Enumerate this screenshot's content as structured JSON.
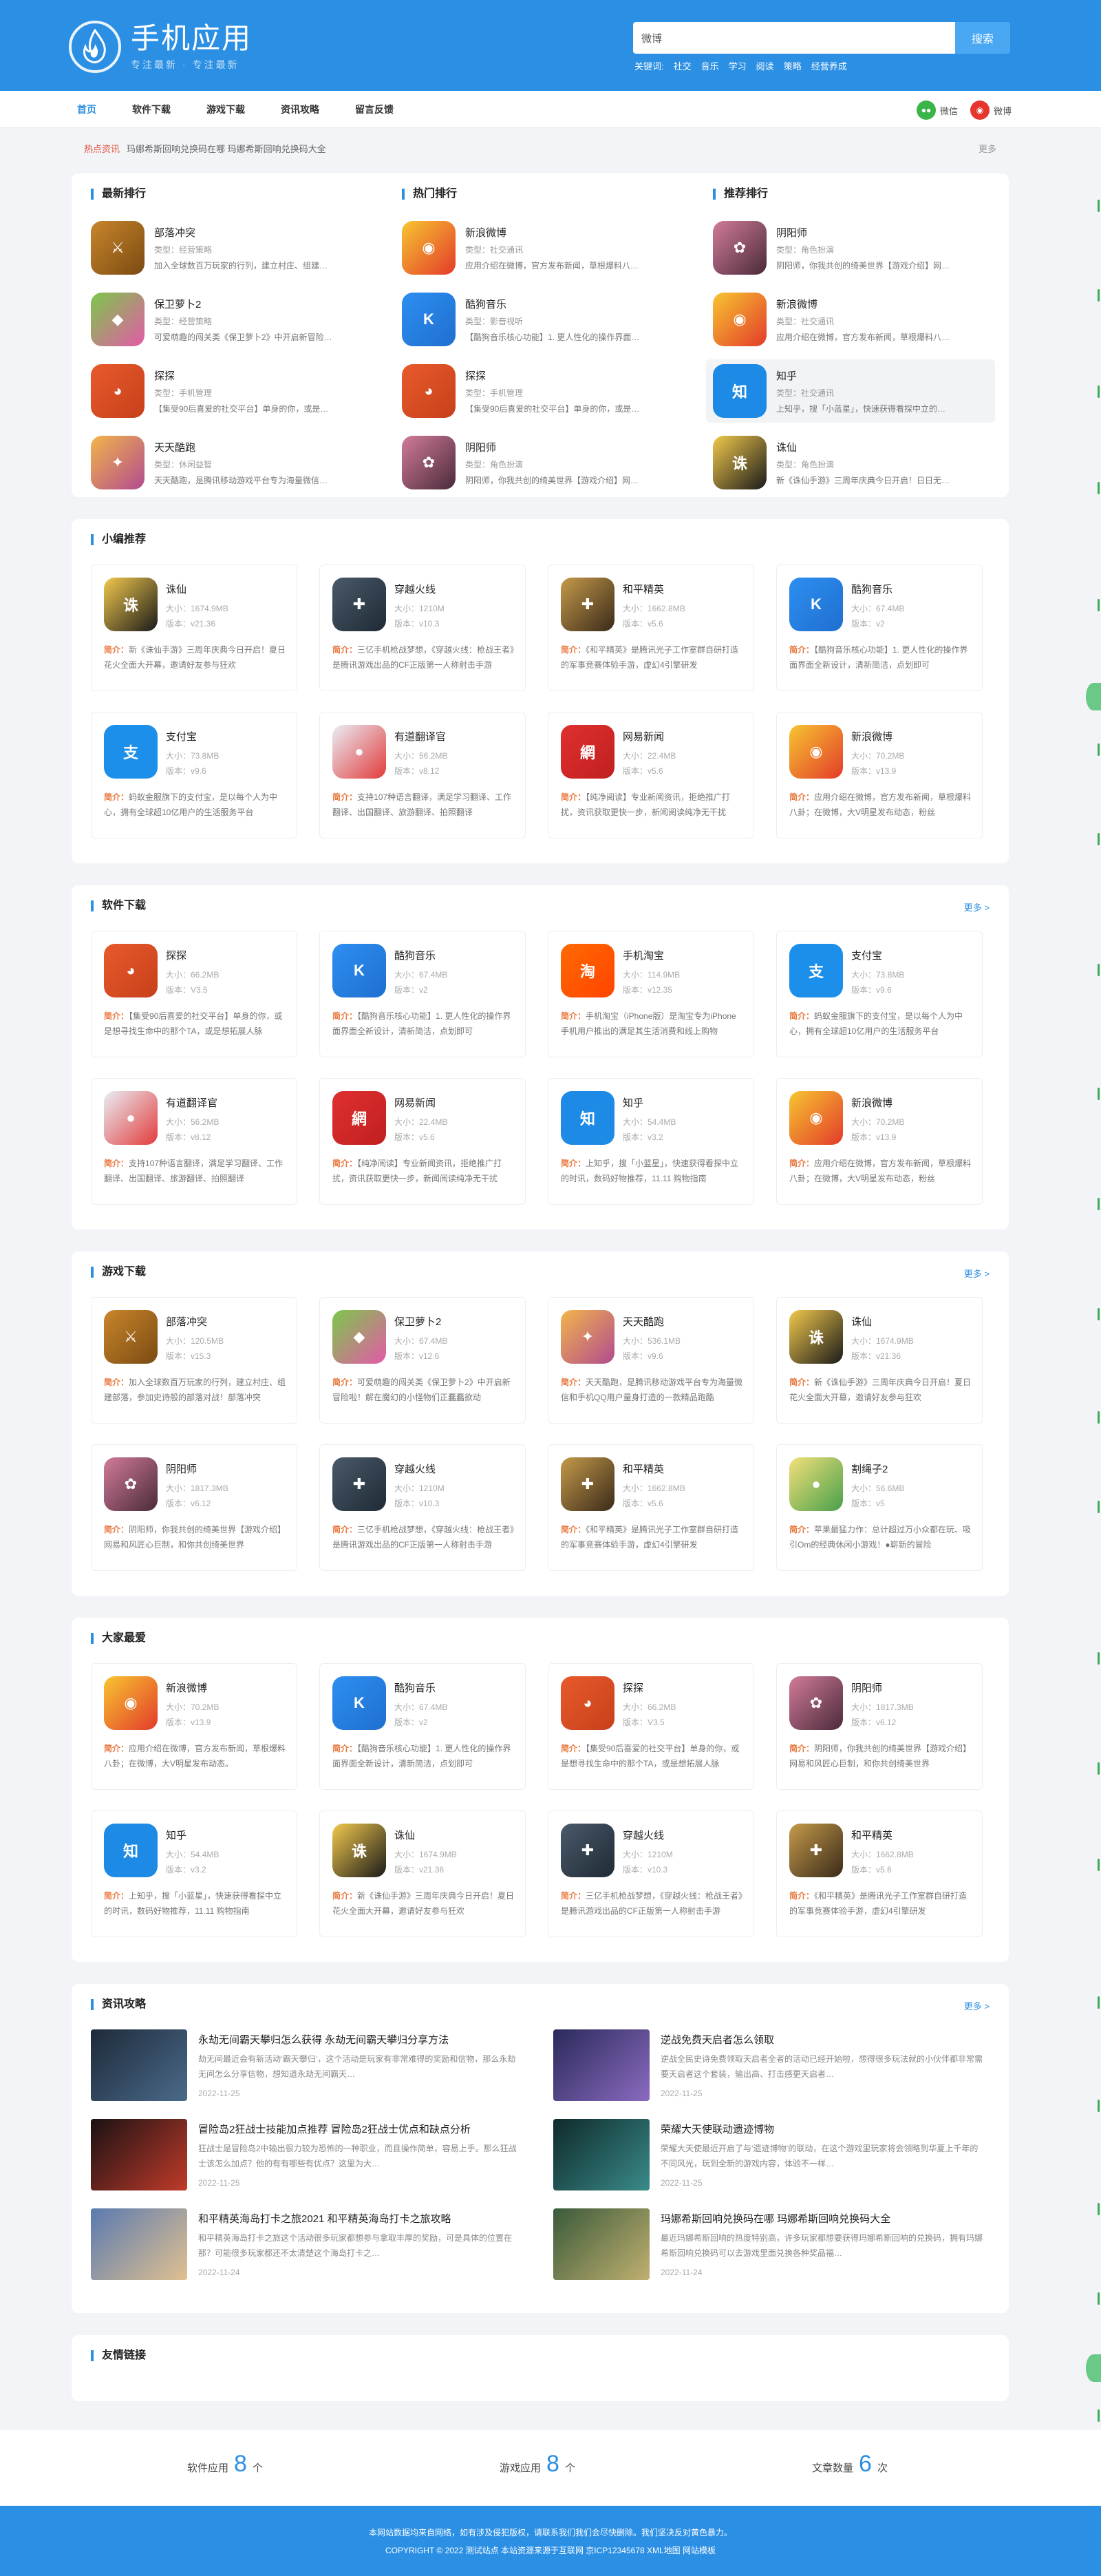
{
  "header": {
    "title": "手机应用",
    "slogan": "专注最新 · 专注最新",
    "search_value": "微博",
    "search_button": "搜索",
    "hotwords_label": "关键词:",
    "hotwords": [
      "社交",
      "音乐",
      "学习",
      "阅读",
      "策略",
      "经营养成"
    ]
  },
  "nav": {
    "items": [
      "首页",
      "软件下载",
      "游戏下载",
      "资讯攻略",
      "留言反馈"
    ],
    "share": [
      "微信",
      "微博"
    ]
  },
  "ticker": {
    "label": "热点资讯",
    "text": "玛娜希斯回响兑换码在哪 玛娜希斯回响兑换码大全",
    "more": "更多"
  },
  "rank": {
    "columns": [
      {
        "title": "最新排行",
        "items": [
          {
            "name": "部落冲突",
            "type": "类型：经营策略",
            "desc": "加入全球数百万玩家的行列，建立村庄、组建…"
          },
          {
            "name": "保卫萝卜2",
            "type": "类型：经营策略",
            "desc": "可爱萌趣的闯关类《保卫萝卜2》中开启新冒险…"
          },
          {
            "name": "探探",
            "type": "类型：手机管理",
            "desc": "【集受90后喜爱的社交平台】单身的你，或是…"
          },
          {
            "name": "天天酷跑",
            "type": "类型：休闲益智",
            "desc": "天天酷跑，是腾讯移动游戏平台专为海量微信…"
          }
        ]
      },
      {
        "title": "热门排行",
        "items": [
          {
            "name": "新浪微博",
            "type": "类型：社交通讯",
            "desc": "应用介绍在微博，官方发布新闻，草根爆料八…"
          },
          {
            "name": "酷狗音乐",
            "type": "类型：影音视听",
            "desc": "【酷狗音乐核心功能】1. 更人性化的操作界面…"
          },
          {
            "name": "探探",
            "type": "类型：手机管理",
            "desc": "【集受90后喜爱的社交平台】单身的你，或是…"
          },
          {
            "name": "阴阳师",
            "type": "类型：角色扮演",
            "desc": "阴阳师，你我共创的绮美世界【游戏介绍】网…"
          }
        ]
      },
      {
        "title": "推荐排行",
        "items": [
          {
            "name": "阴阳师",
            "type": "类型：角色扮演",
            "desc": "阴阳师，你我共创的绮美世界【游戏介绍】网…"
          },
          {
            "name": "新浪微博",
            "type": "类型：社交通讯",
            "desc": "应用介绍在微博，官方发布新闻，草根爆料八…"
          },
          {
            "name": "知乎",
            "type": "类型：社交通讯",
            "desc": "上知乎，搜「小蓝星」，快速获得看探中立的…"
          },
          {
            "name": "诛仙",
            "type": "类型：角色扮演",
            "desc": "新《诛仙手游》三周年庆典今日开启！日日无…"
          }
        ]
      }
    ]
  },
  "sections": [
    {
      "title": "小编推荐",
      "more": "",
      "cards": [
        {
          "name": "诛仙",
          "size": "大小：1674.9MB",
          "ver": "版本：v21.36",
          "desc": "新《诛仙手游》三周年庆典今日开启！夏日花火全面大开幕，邀请好友参与狂欢"
        },
        {
          "name": "穿越火线",
          "size": "大小：1210M",
          "ver": "版本：v10.3",
          "desc": "三亿手机枪战梦想，《穿越火线：枪战王者》是腾讯游戏出品的CF正版第一人称射击手游"
        },
        {
          "name": "和平精英",
          "size": "大小：1662.8MB",
          "ver": "版本：v5.6",
          "desc": "《和平精英》是腾讯光子工作室群自研打造的军事竞赛体验手游，虚幻4引擎研发"
        },
        {
          "name": "酷狗音乐",
          "size": "大小：67.4MB",
          "ver": "版本：v2",
          "desc": "【酷狗音乐核心功能】1. 更人性化的操作界面界面全新设计，清新简洁，点划即可"
        },
        {
          "name": "支付宝",
          "size": "大小：73.8MB",
          "ver": "版本：v9.6",
          "desc": "蚂蚁金服旗下的支付宝，是以每个人为中心，拥有全球超10亿用户的生活服务平台"
        },
        {
          "name": "有道翻译官",
          "size": "大小：56.2MB",
          "ver": "版本：v8.12",
          "desc": "支持107种语言翻译，满足学习翻译、工作翻译、出国翻译、旅游翻译、拍照翻译"
        },
        {
          "name": "网易新闻",
          "size": "大小：22.4MB",
          "ver": "版本：v5.6",
          "desc": "【纯净阅读】专业新闻资讯，拒绝推广打扰，资讯获取更快一步，新闻阅读纯净无干扰"
        },
        {
          "name": "新浪微博",
          "size": "大小：70.2MB",
          "ver": "版本：v13.9",
          "desc": "应用介绍在微博，官方发布新闻，草根爆料八卦；在微博，大V明星发布动态，粉丝"
        }
      ]
    },
    {
      "title": "软件下载",
      "more": "更多 >",
      "cards": [
        {
          "name": "探探",
          "size": "大小：66.2MB",
          "ver": "版本：V3.5",
          "desc": "【集受90后喜爱的社交平台】单身的你，或是想寻找生命中的那个TA，或是想拓展人脉"
        },
        {
          "name": "酷狗音乐",
          "size": "大小：67.4MB",
          "ver": "版本：v2",
          "desc": "【酷狗音乐核心功能】1. 更人性化的操作界面界面全新设计，清新简洁，点划即可"
        },
        {
          "name": "手机淘宝",
          "size": "大小：114.9MB",
          "ver": "版本：v12.35",
          "desc": "手机淘宝（iPhone版）是淘宝专为iPhone手机用户推出的满足其生活消费和线上购物"
        },
        {
          "name": "支付宝",
          "size": "大小：73.8MB",
          "ver": "版本：v9.6",
          "desc": "蚂蚁金服旗下的支付宝，是以每个人为中心，拥有全球超10亿用户的生活服务平台"
        },
        {
          "name": "有道翻译官",
          "size": "大小：56.2MB",
          "ver": "版本：v8.12",
          "desc": "支持107种语言翻译，满足学习翻译、工作翻译、出国翻译、旅游翻译、拍照翻译"
        },
        {
          "name": "网易新闻",
          "size": "大小：22.4MB",
          "ver": "版本：v5.6",
          "desc": "【纯净阅读】专业新闻资讯，拒绝推广打扰，资讯获取更快一步，新闻阅读纯净无干扰"
        },
        {
          "name": "知乎",
          "size": "大小：54.4MB",
          "ver": "版本：v3.2",
          "desc": "上知乎，搜「小蓝星」，快速获得看探中立的时讯，数码好物推荐，11.11 购物指南"
        },
        {
          "name": "新浪微博",
          "size": "大小：70.2MB",
          "ver": "版本：v13.9",
          "desc": "应用介绍在微博，官方发布新闻，草根爆料八卦；在微博，大V明星发布动态，粉丝"
        }
      ]
    },
    {
      "title": "游戏下载",
      "more": "更多 >",
      "cards": [
        {
          "name": "部落冲突",
          "size": "大小：120.5MB",
          "ver": "版本：v15.3",
          "desc": "加入全球数百万玩家的行列，建立村庄、组建部落，参加史诗般的部落对战！部落冲突"
        },
        {
          "name": "保卫萝卜2",
          "size": "大小：67.4MB",
          "ver": "版本：v12.6",
          "desc": "可爱萌趣的闯关类《保卫萝卜2》中开启新冒险啦！解在魔幻的小怪物们正蠢蠢欲动"
        },
        {
          "name": "天天酷跑",
          "size": "大小：536.1MB",
          "ver": "版本：v9.6",
          "desc": "天天酷跑，是腾讯移动游戏平台专为海量微信和手机QQ用户量身打造的一款精品跑酷"
        },
        {
          "name": "诛仙",
          "size": "大小：1674.9MB",
          "ver": "版本：v21.36",
          "desc": "新《诛仙手游》三周年庆典今日开启！夏日花火全面大开幕，邀请好友参与狂欢"
        },
        {
          "name": "阴阳师",
          "size": "大小：1817.3MB",
          "ver": "版本：v6.12",
          "desc": "阴阳师，你我共创的绮美世界【游戏介绍】网易和风匠心巨制，和你共创绮美世界"
        },
        {
          "name": "穿越火线",
          "size": "大小：1210M",
          "ver": "版本：v10.3",
          "desc": "三亿手机枪战梦想，《穿越火线：枪战王者》是腾讯游戏出品的CF正版第一人称射击手游"
        },
        {
          "name": "和平精英",
          "size": "大小：1662.8MB",
          "ver": "版本：v5.6",
          "desc": "《和平精英》是腾讯光子工作室群自研打造的军事竞赛体验手游，虚幻4引擎研发"
        },
        {
          "name": "割绳子2",
          "size": "大小：56.6MB",
          "ver": "版本：v5",
          "desc": "苹果最猛力作：总计超过万小众都在玩、吸引Om的经典休闲小游戏！●崭新的冒险"
        }
      ]
    },
    {
      "title": "大家最爱",
      "more": "",
      "cards": [
        {
          "name": "新浪微博",
          "size": "大小：70.2MB",
          "ver": "版本：v13.9",
          "desc": "应用介绍在微博，官方发布新闻，草根爆料八卦；在微博，大V明星发布动态。"
        },
        {
          "name": "酷狗音乐",
          "size": "大小：67.4MB",
          "ver": "版本：v2",
          "desc": "【酷狗音乐核心功能】1. 更人性化的操作界面界面全新设计，清新简洁，点划即可"
        },
        {
          "name": "探探",
          "size": "大小：66.2MB",
          "ver": "版本：V3.5",
          "desc": "【集受90后喜爱的社交平台】单身的你，或是想寻找生命中的那个TA，或是想拓展人脉"
        },
        {
          "name": "阴阳师",
          "size": "大小：1817.3MB",
          "ver": "版本：v6.12",
          "desc": "阴阳师，你我共创的绮美世界【游戏介绍】网易和风匠心巨制，和你共创绮美世界"
        },
        {
          "name": "知乎",
          "size": "大小：54.4MB",
          "ver": "版本：v3.2",
          "desc": "上知乎，搜「小蓝星」，快速获得看探中立的时讯，数码好物推荐，11.11 购物指南"
        },
        {
          "name": "诛仙",
          "size": "大小：1674.9MB",
          "ver": "版本：v21.36",
          "desc": "新《诛仙手游》三周年庆典今日开启！夏日花火全面大开幕，邀请好友参与狂欢"
        },
        {
          "name": "穿越火线",
          "size": "大小：1210M",
          "ver": "版本：v10.3",
          "desc": "三亿手机枪战梦想，《穿越火线：枪战王者》是腾讯游戏出品的CF正版第一人称射击手游"
        },
        {
          "name": "和平精英",
          "size": "大小：1662.8MB",
          "ver": "版本：v5.6",
          "desc": "《和平精英》是腾讯光子工作室群自研打造的军事竞赛体验手游，虚幻4引擎研发"
        }
      ]
    }
  ],
  "desc_label": "简介：",
  "news": {
    "title": "资讯攻略",
    "more": "更多 >",
    "items": [
      {
        "title": "永劫无间霸天攀归怎么获得 永劫无间霸天攀归分享方法",
        "desc": "劫无间最近会有新活动‘霸天攀归’，这个活动是玩家有非常难得的奖励和信物，那么永劫无间怎么分享信物，想知道永劫无间霸天…",
        "date": "2022-11-25"
      },
      {
        "title": "逆战免费天启者怎么领取",
        "desc": "逆战全民史诗免费领取天启者全者的活动已经开始啦，想得很多玩法就的小伙伴都非常需要天启者这个套装，输出高、打击感更天启者…",
        "date": "2022-11-25"
      },
      {
        "title": "冒险岛2狂战士技能加点推荐 冒险岛2狂战士优点和缺点分析",
        "desc": "狂战士是冒险岛2中输出很力较为恐怖的一种职业，而且操作简单，容易上手。那么狂战士该怎么加点？他的有有哪些有优点？这里为大…",
        "date": "2022-11-25"
      },
      {
        "title": "荣耀大天使联动遗迹博物",
        "desc": "荣耀大天使最近开启了与‘遗迹博物’的联动，在这个游戏里玩家将会领略到华夏上千年的不同风光，玩到全新的游戏内容，体验不一样…",
        "date": "2022-11-25"
      },
      {
        "title": "和平精英海岛打卡之旅2021 和平精英海岛打卡之旅攻略",
        "desc": "和平精英海岛打卡之旅这个活动很多玩家都想参与拿取丰厚的奖励，可是具体的位置在那？可能很多玩家都还不太清楚这个海岛打卡之…",
        "date": "2022-11-24"
      },
      {
        "title": "玛娜希斯回响兑换码在哪 玛娜希斯回响兑换码大全",
        "desc": "最近玛娜希斯回响的热度特别高，许多玩家都想要获得玛娜希斯回响的兑换码，拥有玛娜希斯回响兑换码可以去游戏里面兑换各种奖品福…",
        "date": "2022-11-24"
      }
    ]
  },
  "links": {
    "title": "友情链接"
  },
  "stats": {
    "items": [
      {
        "label": "软件应用",
        "num": "8",
        "unit": "个"
      },
      {
        "label": "游戏应用",
        "num": "8",
        "unit": "个"
      },
      {
        "label": "文章数量",
        "num": "6",
        "unit": "次"
      }
    ]
  },
  "footer": {
    "line1": "本网站数据均来自网络，如有涉及侵犯版权，请联系我们我们会尽快删除。我们坚决反对黄色暴力。",
    "line2": "COPYRIGHT © 2022 测试站点 本站资源来源于互联网 京ICP12345678 XML地图 网站模板"
  },
  "colors": {
    "primary": "#2b8fe4",
    "accent": "#e8763b",
    "hot": "#e5533d"
  }
}
